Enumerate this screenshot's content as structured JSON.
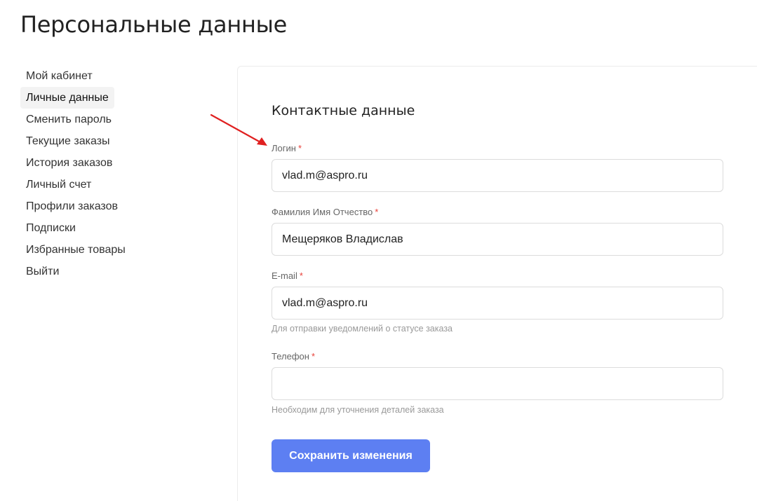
{
  "page": {
    "title": "Персональные данные"
  },
  "sidebar": {
    "items": [
      {
        "label": "Мой кабинет",
        "active": false
      },
      {
        "label": "Личные данные",
        "active": true
      },
      {
        "label": "Сменить пароль",
        "active": false
      },
      {
        "label": "Текущие заказы",
        "active": false
      },
      {
        "label": "История заказов",
        "active": false
      },
      {
        "label": "Личный счет",
        "active": false
      },
      {
        "label": "Профили заказов",
        "active": false
      },
      {
        "label": "Подписки",
        "active": false
      },
      {
        "label": "Избранные товары",
        "active": false
      },
      {
        "label": "Выйти",
        "active": false
      }
    ]
  },
  "form": {
    "section_title": "Контактные данные",
    "required_mark": "*",
    "login": {
      "label": "Логин",
      "value": "vlad.m@aspro.ru"
    },
    "fullname": {
      "label": "Фамилия Имя Отчество",
      "value": "Мещеряков Владислав"
    },
    "email": {
      "label": "E-mail",
      "value": "vlad.m@aspro.ru",
      "hint": "Для отправки уведомлений о статусе заказа"
    },
    "phone": {
      "label": "Телефон",
      "value": "",
      "hint": "Необходим для уточнения деталей заказа"
    },
    "save_label": "Сохранить изменения"
  },
  "colors": {
    "accent": "#5d7ff2",
    "required": "#e8413a",
    "annotation_arrow": "#e02020"
  },
  "icons": {
    "annotation": "red-arrow-icon"
  }
}
